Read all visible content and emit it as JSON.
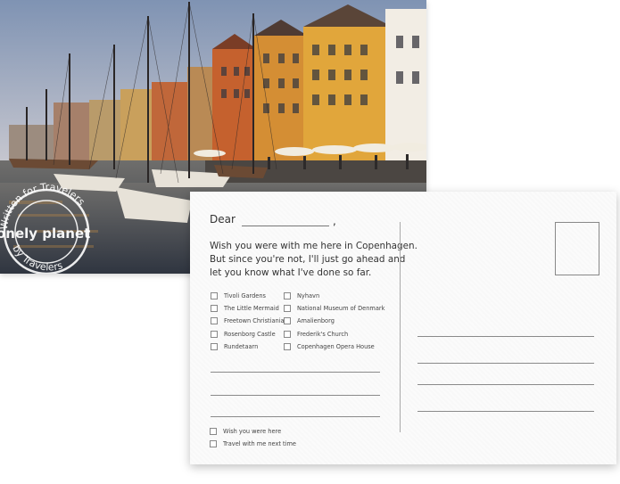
{
  "watermark": {
    "brand": "lonely planet",
    "ring_text": "Written for Travelers by Travelers"
  },
  "postcard": {
    "greeting": "Dear",
    "comma": ",",
    "message_lines": [
      "Wish you were with me here in Copenhagen.",
      "But since you're not, I'll just go ahead and",
      "let you know what I've done so far."
    ],
    "checklist_left": [
      "Tivoli Gardens",
      "The Little Mermaid",
      "Freetown Christiania",
      "Rosenborg Castle",
      "Rundetaarn"
    ],
    "checklist_right": [
      "Nyhavn",
      "National Museum of Denmark",
      "Amalienborg",
      "Frederik's Church",
      "Copenhagen Opera House"
    ],
    "closing_options": [
      "Wish you were here",
      "Travel with me next time"
    ]
  },
  "colors": {
    "sky": "#a9b9cf",
    "building_yellow": "#d9a23a",
    "building_orange": "#c9702e",
    "water": "#4b5361"
  }
}
